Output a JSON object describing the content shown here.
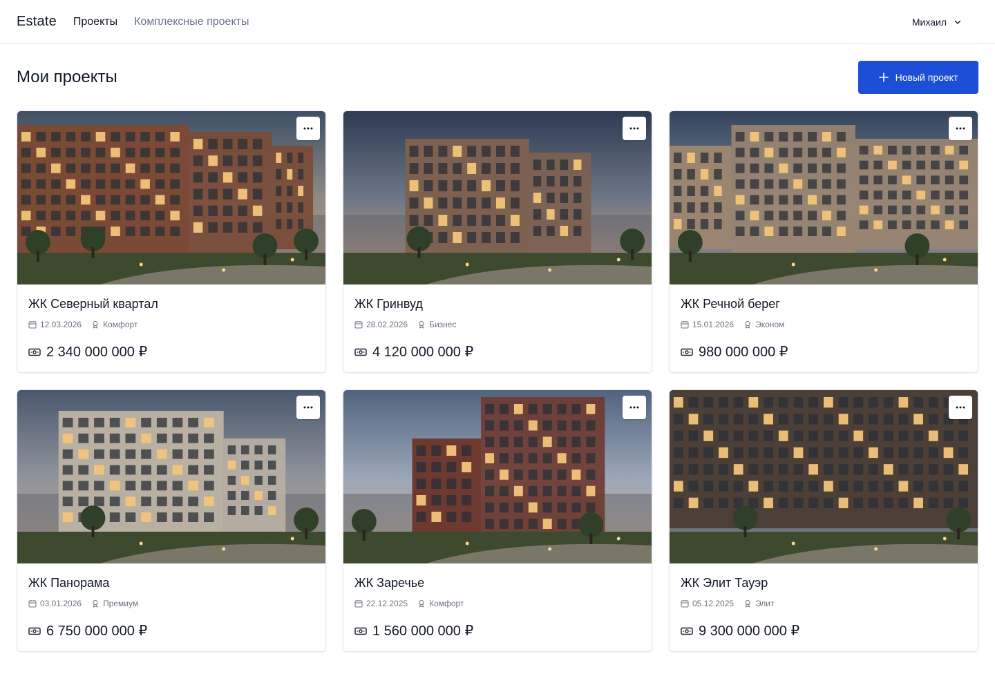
{
  "header": {
    "brand": "Estate",
    "nav": [
      "Проекты",
      "Комплексные проекты"
    ],
    "user": "Михаил"
  },
  "page": {
    "title": "Мои проекты",
    "new_button": "Новый проект"
  },
  "projects": [
    {
      "title": "ЖК Северный квартал",
      "date": "12.03.2026",
      "class": "Комфорт",
      "price": "2 340 000 000 ₽",
      "sky": [
        "#3f5066",
        "#8e8a86",
        "#c9a27a"
      ],
      "facade": "#7a4a36"
    },
    {
      "title": "ЖК Гринвуд",
      "date": "28.02.2026",
      "class": "Бизнес",
      "price": "4 120 000 000 ₽",
      "sky": [
        "#2e3b52",
        "#6c7686",
        "#d8a679"
      ],
      "facade": "#7d6150"
    },
    {
      "title": "ЖК Речной берег",
      "date": "15.01.2026",
      "class": "Эконом",
      "price": "980 000 000 ₽",
      "sky": [
        "#34445c",
        "#7a8596",
        "#b7aa98"
      ],
      "facade": "#9a8570"
    },
    {
      "title": "ЖК Панорама",
      "date": "03.01.2026",
      "class": "Премиум",
      "price": "6 750 000 000 ₽",
      "sky": [
        "#4a586e",
        "#8f939b",
        "#c7a88e"
      ],
      "facade": "#b9b0a4"
    },
    {
      "title": "ЖК Заречье",
      "date": "22.12.2025",
      "class": "Комфорт",
      "price": "1 560 000 000 ₽",
      "sky": [
        "#51637e",
        "#9aa6b7",
        "#d7b28f"
      ],
      "facade": "#6e3a30"
    },
    {
      "title": "ЖК Элит Тауэр",
      "date": "05.12.2025",
      "class": "Элит",
      "price": "9 300 000 000 ₽",
      "sky": [
        "#3a4658",
        "#6b7381",
        "#8e8f92"
      ],
      "facade": "#4b3f38"
    }
  ]
}
